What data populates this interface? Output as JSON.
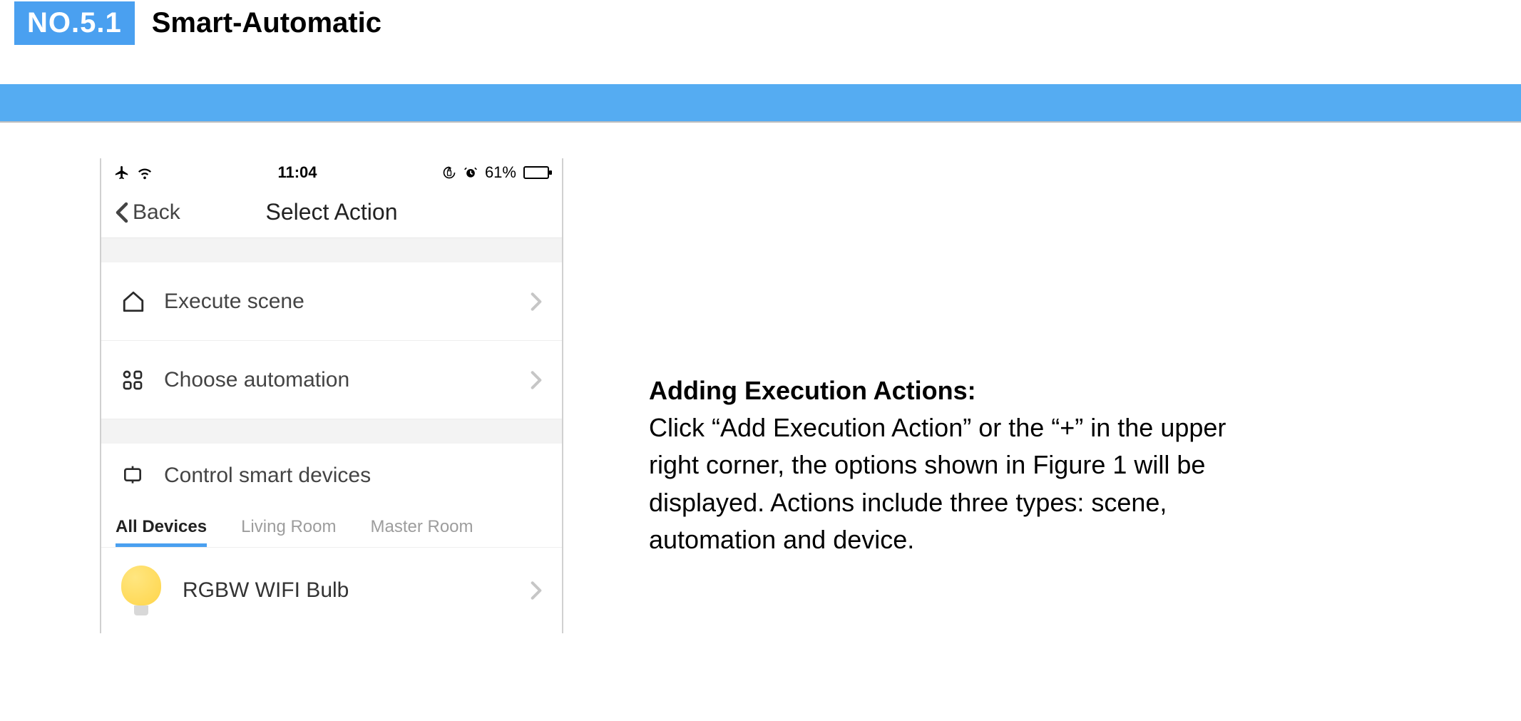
{
  "header": {
    "badge": "NO.5.1",
    "title": "Smart-Automatic"
  },
  "phone": {
    "status": {
      "time": "11:04",
      "battery_pct": "61%"
    },
    "nav": {
      "back": "Back",
      "title": "Select Action"
    },
    "rows": {
      "execute_scene": "Execute scene",
      "choose_automation": "Choose automation"
    },
    "section": {
      "control_smart": "Control smart devices"
    },
    "tabs": {
      "all": "All Devices",
      "living": "Living Room",
      "master": "Master Room"
    },
    "device": {
      "rgbw": "RGBW WIFI Bulb"
    }
  },
  "desc": {
    "heading": "Adding Execution Actions:",
    "body": "Click “Add Execution Action” or the “+” in the upper right corner, the options shown in Figure 1 will be displayed. Actions include three types: scene, automation and device."
  }
}
